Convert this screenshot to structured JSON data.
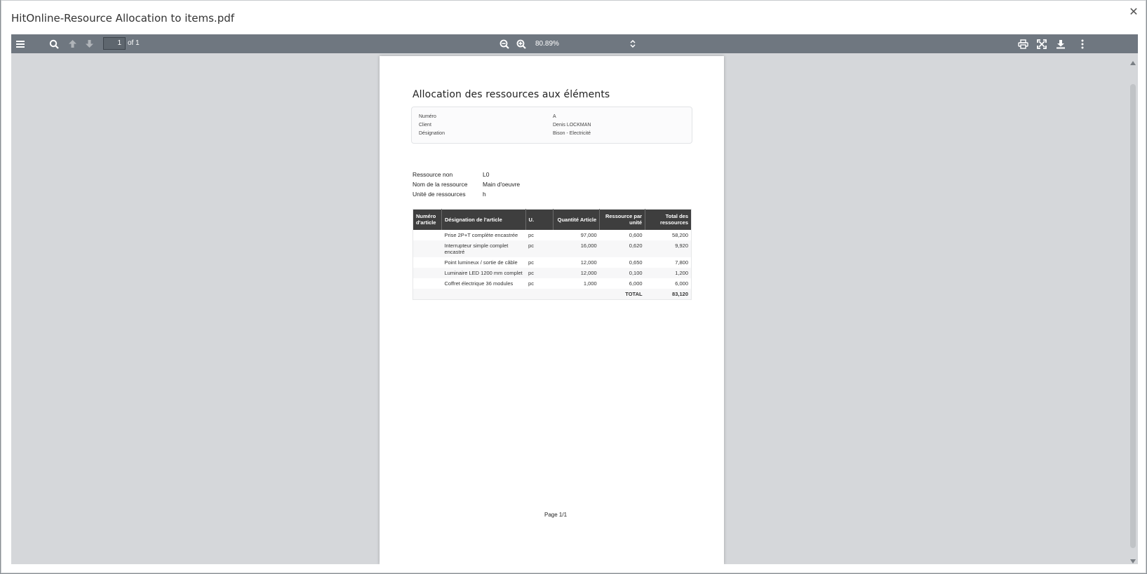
{
  "modal": {
    "title": "HitOnline-Resource Allocation to items.pdf",
    "close_icon": "close-icon"
  },
  "toolbar": {
    "page_number": "1",
    "page_of": "of 1",
    "zoom": "80.89%",
    "icons": [
      "menu-icon",
      "search-icon",
      "arrow-up-icon",
      "arrow-down-icon",
      "zoom-out-icon",
      "zoom-in-icon",
      "chevron-updown-icon",
      "print-icon",
      "fullscreen-icon",
      "download-icon",
      "more-vertical-icon"
    ]
  },
  "document": {
    "title": "Allocation des ressources aux éléments",
    "info": [
      {
        "label": "Numéro",
        "value": "A"
      },
      {
        "label": "Client",
        "value": "Denis LOCKMAN"
      },
      {
        "label": "Désignation",
        "value": "Bison - Electricité"
      }
    ],
    "resource": [
      {
        "label": "Ressource non",
        "value": "L0"
      },
      {
        "label": "Nom de la ressource",
        "value": "Main d'oeuvre"
      },
      {
        "label": "Unité de ressources",
        "value": "h"
      }
    ],
    "table": {
      "headers": [
        "Numéro d'article",
        "Désignation de l'article",
        "U.",
        "Quantité Article",
        "Ressource par unité",
        "Total des ressources"
      ],
      "rows": [
        {
          "num": "",
          "designation": "Prise 2P+T complète encastrée",
          "unit": "pc",
          "qty": "97,000",
          "per_unit": "0,600",
          "total": "58,200"
        },
        {
          "num": "",
          "designation": "Interrupteur simple complet encastré",
          "unit": "pc",
          "qty": "16,000",
          "per_unit": "0,620",
          "total": "9,920"
        },
        {
          "num": "",
          "designation": "Point lumineux / sortie de câble",
          "unit": "pc",
          "qty": "12,000",
          "per_unit": "0,650",
          "total": "7,800"
        },
        {
          "num": "",
          "designation": "Luminaire LED 1200 mm complet",
          "unit": "pc",
          "qty": "12,000",
          "per_unit": "0,100",
          "total": "1,200"
        },
        {
          "num": "",
          "designation": "Coffret électrique 36 modules",
          "unit": "pc",
          "qty": "1,000",
          "per_unit": "6,000",
          "total": "6,000"
        }
      ],
      "total_label": "TOTAL",
      "total_value": "83,120"
    },
    "footer": "Page  1/1"
  },
  "colors": {
    "toolbar_bg": "#6f7780",
    "viewer_bg": "#d5d7da",
    "table_header_bg": "#3e3e3e"
  }
}
